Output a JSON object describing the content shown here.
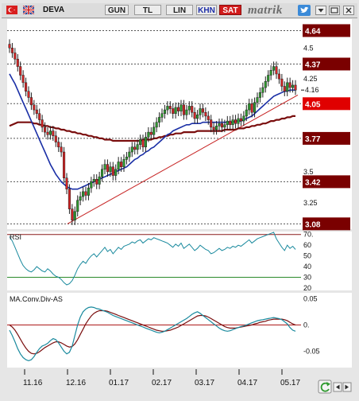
{
  "toolbar": {
    "symbol": "DEVA",
    "buttons": [
      "GUN",
      "TL",
      "LIN"
    ],
    "khn_label": "KHN",
    "sat_label": "SAT",
    "brand": "matrik",
    "colors": {
      "khn": "#1e2fa8",
      "sat": "#d11b1b"
    }
  },
  "chart_data": [
    {
      "type": "candlestick",
      "panel": "price",
      "symbol": "DEVA",
      "x_dates": [
        "11.16",
        "12.16",
        "01.17",
        "02.17",
        "03.17",
        "04.17",
        "05.17"
      ],
      "ylim": [
        3.05,
        4.72
      ],
      "y_ticks": [
        3.25,
        3.5,
        4.25,
        4.5
      ],
      "level_lines": [
        4.64,
        4.37,
        4.05,
        3.77,
        3.42,
        3.08
      ],
      "level_colors": {
        "4.64": "#7a0000",
        "4.37": "#7a0000",
        "4.05": "#e00000",
        "3.77": "#7a0000",
        "3.42": "#7a0000",
        "3.08": "#7a0000"
      },
      "current_price": 4.16,
      "close": [
        4.5,
        4.46,
        4.41,
        4.35,
        4.28,
        4.22,
        4.15,
        4.1,
        4.04,
        4.0,
        3.97,
        3.92,
        3.86,
        3.82,
        3.8,
        3.83,
        3.79,
        3.74,
        3.7,
        3.66,
        3.45,
        3.36,
        3.2,
        3.11,
        3.18,
        3.27,
        3.3,
        3.34,
        3.31,
        3.37,
        3.42,
        3.44,
        3.4,
        3.46,
        3.52,
        3.56,
        3.5,
        3.54,
        3.47,
        3.52,
        3.58,
        3.54,
        3.6,
        3.62,
        3.66,
        3.7,
        3.68,
        3.72,
        3.76,
        3.7,
        3.78,
        3.82,
        3.8,
        3.86,
        3.9,
        3.94,
        3.97,
        4.0,
        4.03,
        4.01,
        3.97,
        4.02,
        3.99,
        4.04,
        3.96,
        4.0,
        4.03,
        3.98,
        3.93,
        3.96,
        4.01,
        3.98,
        3.95,
        3.92,
        3.86,
        3.84,
        3.87,
        3.89,
        3.86,
        3.88,
        3.91,
        3.88,
        3.92,
        3.89,
        3.93,
        3.91,
        3.95,
        4.0,
        4.05,
        3.98,
        4.06,
        4.1,
        4.14,
        4.18,
        4.23,
        4.28,
        4.32,
        4.35,
        4.29,
        4.25,
        4.19,
        4.15,
        4.22,
        4.18,
        4.2,
        4.16
      ],
      "indicators": [
        {
          "name": "MA short",
          "color": "#1a2fa6",
          "values": [
            4.29,
            4.25,
            4.21,
            4.16,
            4.11,
            4.06,
            4.01,
            3.96,
            3.91,
            3.86,
            3.81,
            3.76,
            3.71,
            3.66,
            3.61,
            3.56,
            3.52,
            3.48,
            3.45,
            3.42,
            3.4,
            3.38,
            3.37,
            3.36,
            3.36,
            3.36,
            3.37,
            3.38,
            3.39,
            3.4,
            3.41,
            3.42,
            3.43,
            3.44,
            3.45,
            3.46,
            3.47,
            3.48,
            3.49,
            3.5,
            3.51,
            3.52,
            3.53,
            3.54,
            3.56,
            3.58,
            3.6,
            3.61,
            3.63,
            3.64,
            3.66,
            3.67,
            3.69,
            3.7,
            3.72,
            3.74,
            3.76,
            3.78,
            3.8,
            3.81,
            3.83,
            3.84,
            3.85,
            3.86,
            3.87,
            3.88,
            3.88,
            3.89,
            3.89,
            3.89,
            3.89,
            3.9,
            3.9,
            3.9,
            3.9,
            3.9,
            3.9,
            3.9,
            3.9,
            3.9,
            3.9,
            3.9,
            3.9,
            3.91,
            3.91,
            3.91,
            3.92,
            3.93,
            3.94,
            3.95,
            3.97,
            3.99,
            4.01,
            4.03,
            4.05,
            4.07,
            4.09,
            4.11,
            4.12,
            4.13,
            4.14,
            4.15,
            4.15,
            4.16,
            4.16,
            4.16
          ]
        },
        {
          "name": "MA long",
          "color": "#7a0e0e",
          "values": [
            3.87,
            3.88,
            3.89,
            3.9,
            3.9,
            3.9,
            3.9,
            3.9,
            3.9,
            3.89,
            3.89,
            3.88,
            3.88,
            3.87,
            3.87,
            3.86,
            3.86,
            3.85,
            3.85,
            3.84,
            3.84,
            3.83,
            3.83,
            3.82,
            3.82,
            3.81,
            3.81,
            3.8,
            3.8,
            3.79,
            3.79,
            3.78,
            3.78,
            3.77,
            3.77,
            3.76,
            3.76,
            3.76,
            3.75,
            3.75,
            3.75,
            3.75,
            3.75,
            3.75,
            3.75,
            3.75,
            3.75,
            3.75,
            3.75,
            3.76,
            3.76,
            3.76,
            3.76,
            3.77,
            3.77,
            3.78,
            3.78,
            3.79,
            3.79,
            3.8,
            3.8,
            3.81,
            3.81,
            3.81,
            3.82,
            3.82,
            3.82,
            3.82,
            3.82,
            3.83,
            3.83,
            3.83,
            3.83,
            3.83,
            3.83,
            3.83,
            3.83,
            3.83,
            3.83,
            3.84,
            3.84,
            3.84,
            3.84,
            3.84,
            3.85,
            3.85,
            3.85,
            3.86,
            3.86,
            3.87,
            3.87,
            3.88,
            3.88,
            3.89,
            3.89,
            3.9,
            3.91,
            3.91,
            3.92,
            3.92,
            3.93,
            3.93,
            3.94,
            3.94,
            3.95,
            3.95
          ]
        }
      ],
      "trendline": {
        "from": [
          "12.16",
          3.08
        ],
        "to": [
          "05.17",
          4.12
        ],
        "color": "#c62020"
      }
    },
    {
      "type": "line",
      "panel": "RSI",
      "title": "RSI",
      "ylim": [
        20,
        72
      ],
      "y_ticks": [
        70.0,
        60,
        50,
        40,
        30,
        20
      ],
      "y_tick_labels": [
        "70.",
        "60",
        "50",
        "40",
        "30",
        "20"
      ],
      "overbought": 70,
      "oversold": 30,
      "series": [
        {
          "color": "#1a8a9e",
          "values": [
            68,
            64,
            58,
            52,
            46,
            41,
            38,
            36,
            35,
            37,
            40,
            38,
            36,
            35,
            38,
            36,
            33,
            31,
            30,
            28,
            25,
            23,
            24,
            27,
            32,
            38,
            42,
            45,
            43,
            47,
            50,
            52,
            49,
            52,
            55,
            58,
            54,
            56,
            52,
            55,
            58,
            56,
            59,
            60,
            61,
            63,
            62,
            64,
            65,
            62,
            64,
            66,
            65,
            67,
            66,
            65,
            64,
            63,
            62,
            60,
            58,
            61,
            59,
            62,
            57,
            59,
            61,
            58,
            55,
            57,
            60,
            58,
            56,
            55,
            52,
            53,
            55,
            57,
            55,
            56,
            58,
            57,
            59,
            58,
            60,
            59,
            61,
            63,
            65,
            62,
            64,
            66,
            67,
            68,
            69,
            70,
            71,
            72,
            66,
            62,
            58,
            55,
            60,
            57,
            59,
            56
          ]
        }
      ]
    },
    {
      "type": "line",
      "panel": "MACD",
      "title": "MA.Conv.Div-AS",
      "ylim": [
        -0.078,
        0.058
      ],
      "y_ticks": [
        0.05,
        0,
        -0.05
      ],
      "y_tick_labels": [
        "0.05",
        "0.",
        "-0.05"
      ],
      "zero_line_color": "#aa1111",
      "series": [
        {
          "color": "#1a8a9e",
          "values": [
            -0.01,
            -0.02,
            -0.032,
            -0.045,
            -0.055,
            -0.062,
            -0.066,
            -0.068,
            -0.066,
            -0.06,
            -0.052,
            -0.045,
            -0.04,
            -0.038,
            -0.035,
            -0.03,
            -0.026,
            -0.028,
            -0.034,
            -0.042,
            -0.05,
            -0.055,
            -0.052,
            -0.04,
            -0.02,
            0.0,
            0.015,
            0.025,
            0.03,
            0.033,
            0.034,
            0.033,
            0.031,
            0.03,
            0.028,
            0.026,
            0.024,
            0.021,
            0.018,
            0.016,
            0.014,
            0.012,
            0.01,
            0.008,
            0.006,
            0.004,
            0.002,
            0.0,
            -0.002,
            -0.004,
            -0.006,
            -0.008,
            -0.01,
            -0.012,
            -0.014,
            -0.015,
            -0.014,
            -0.012,
            -0.009,
            -0.006,
            -0.003,
            0.0,
            0.003,
            0.006,
            0.009,
            0.012,
            0.016,
            0.02,
            0.023,
            0.025,
            0.022,
            0.018,
            0.014,
            0.01,
            0.006,
            0.002,
            -0.002,
            -0.006,
            -0.009,
            -0.011,
            -0.012,
            -0.011,
            -0.009,
            -0.007,
            -0.005,
            -0.003,
            -0.002,
            0.0,
            0.002,
            0.004,
            0.006,
            0.008,
            0.009,
            0.01,
            0.011,
            0.012,
            0.013,
            0.014,
            0.013,
            0.012,
            0.01,
            0.006,
            0.002,
            -0.005,
            -0.01,
            -0.012
          ]
        },
        {
          "color": "#7a0e0e",
          "values": [
            0.0,
            -0.004,
            -0.01,
            -0.018,
            -0.027,
            -0.036,
            -0.044,
            -0.05,
            -0.054,
            -0.055,
            -0.054,
            -0.051,
            -0.047,
            -0.043,
            -0.04,
            -0.037,
            -0.034,
            -0.032,
            -0.032,
            -0.034,
            -0.037,
            -0.04,
            -0.042,
            -0.041,
            -0.036,
            -0.028,
            -0.018,
            -0.008,
            0.002,
            0.01,
            0.017,
            0.022,
            0.025,
            0.027,
            0.027,
            0.027,
            0.026,
            0.024,
            0.022,
            0.02,
            0.018,
            0.016,
            0.014,
            0.012,
            0.01,
            0.008,
            0.006,
            0.004,
            0.002,
            0.0,
            -0.002,
            -0.004,
            -0.006,
            -0.008,
            -0.01,
            -0.011,
            -0.012,
            -0.012,
            -0.011,
            -0.01,
            -0.008,
            -0.006,
            -0.004,
            -0.001,
            0.002,
            0.005,
            0.008,
            0.011,
            0.014,
            0.017,
            0.018,
            0.018,
            0.017,
            0.015,
            0.012,
            0.009,
            0.006,
            0.003,
            0.0,
            -0.003,
            -0.005,
            -0.006,
            -0.006,
            -0.006,
            -0.005,
            -0.004,
            -0.003,
            -0.002,
            -0.001,
            0.0,
            0.002,
            0.003,
            0.005,
            0.006,
            0.007,
            0.009,
            0.01,
            0.011,
            0.011,
            0.011,
            0.011,
            0.01,
            0.008,
            0.005,
            0.002,
            0.0
          ]
        }
      ]
    }
  ]
}
